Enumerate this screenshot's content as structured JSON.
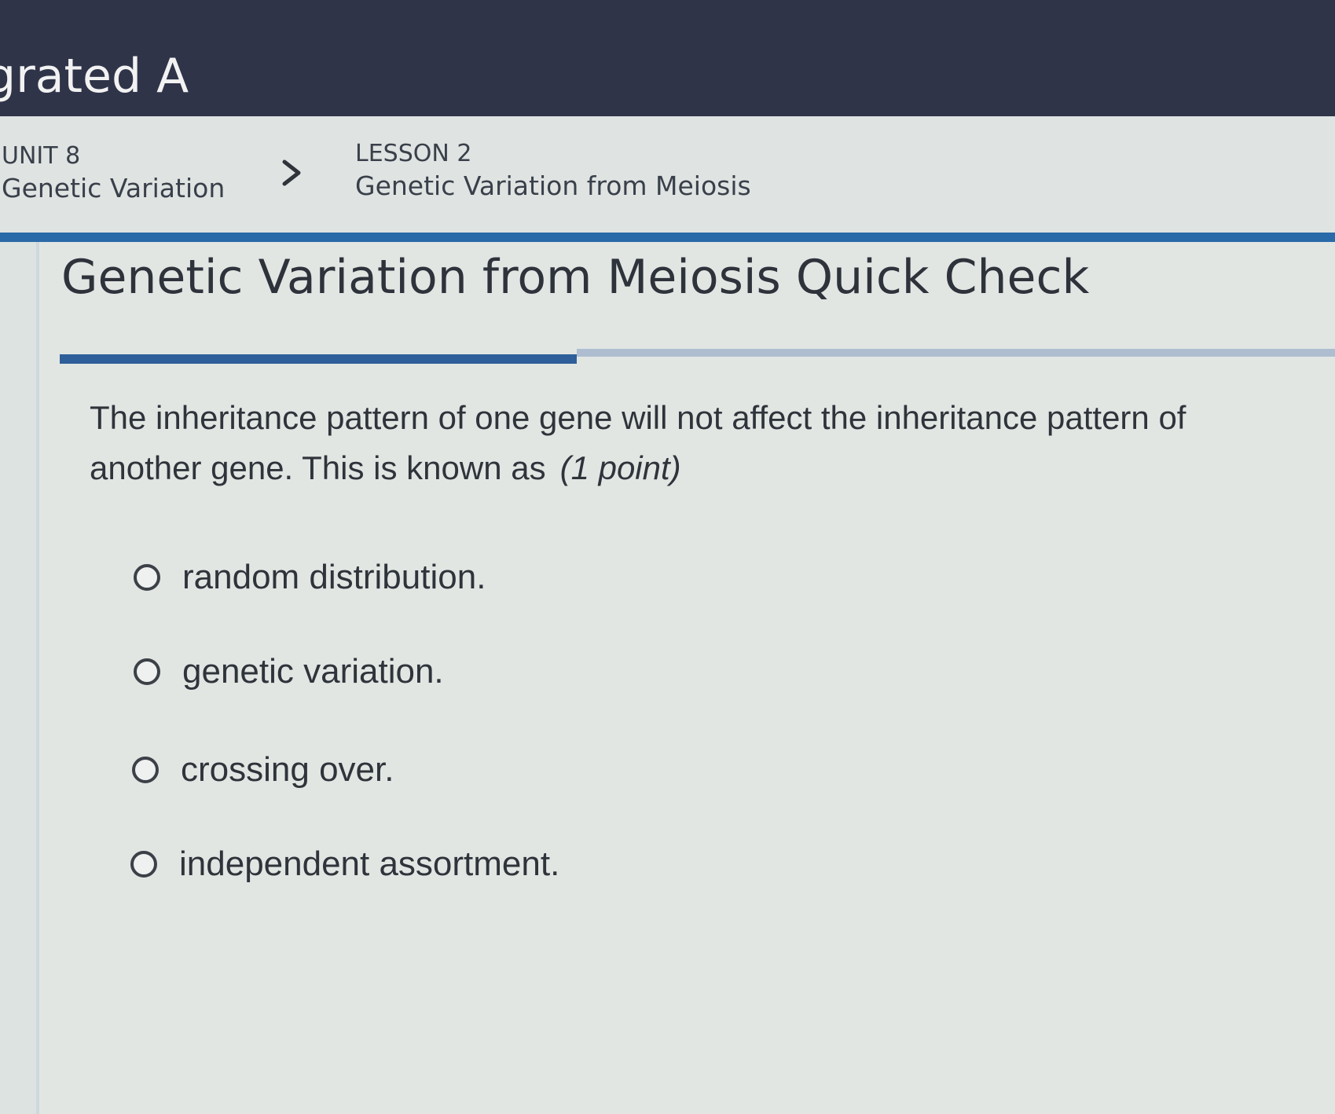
{
  "header": {
    "course_title": "grated A"
  },
  "breadcrumb": {
    "unit_number": "UNIT 8",
    "unit_name": "Genetic Variation",
    "lesson_number": "LESSON 2",
    "lesson_name": "Genetic Variation from Meiosis",
    "separator_icon": "chevron-right-icon"
  },
  "quiz": {
    "title": "Genetic Variation from Meiosis Quick Check",
    "question": "The inheritance pattern of one gene will not affect the inheritance pattern of another gene. This is known as",
    "points": "(1 point)",
    "options": [
      {
        "label": "random distribution.",
        "selected": false
      },
      {
        "label": "genetic variation.",
        "selected": false
      },
      {
        "label": "crossing over.",
        "selected": false
      },
      {
        "label": "independent assortment.",
        "selected": false
      }
    ]
  },
  "colors": {
    "header_bg": "#2f3449",
    "accent_blue": "#2a6aa8",
    "page_bg": "#e2e6e3"
  }
}
